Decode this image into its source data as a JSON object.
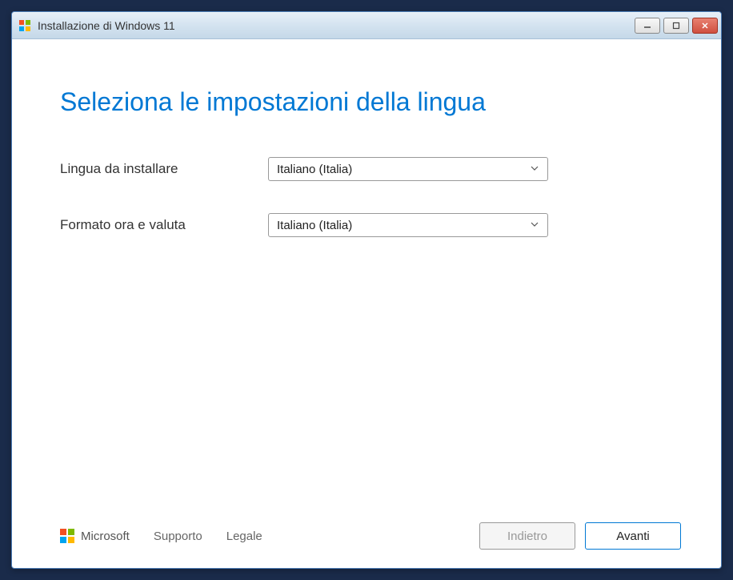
{
  "window": {
    "title": "Installazione di Windows 11"
  },
  "page": {
    "heading": "Seleziona le impostazioni della lingua"
  },
  "form": {
    "language": {
      "label": "Lingua da installare",
      "value": "Italiano (Italia)"
    },
    "locale": {
      "label": "Formato ora e valuta",
      "value": "Italiano (Italia)"
    }
  },
  "footer": {
    "brand": "Microsoft",
    "support": "Supporto",
    "legal": "Legale",
    "back": "Indietro",
    "next": "Avanti"
  }
}
